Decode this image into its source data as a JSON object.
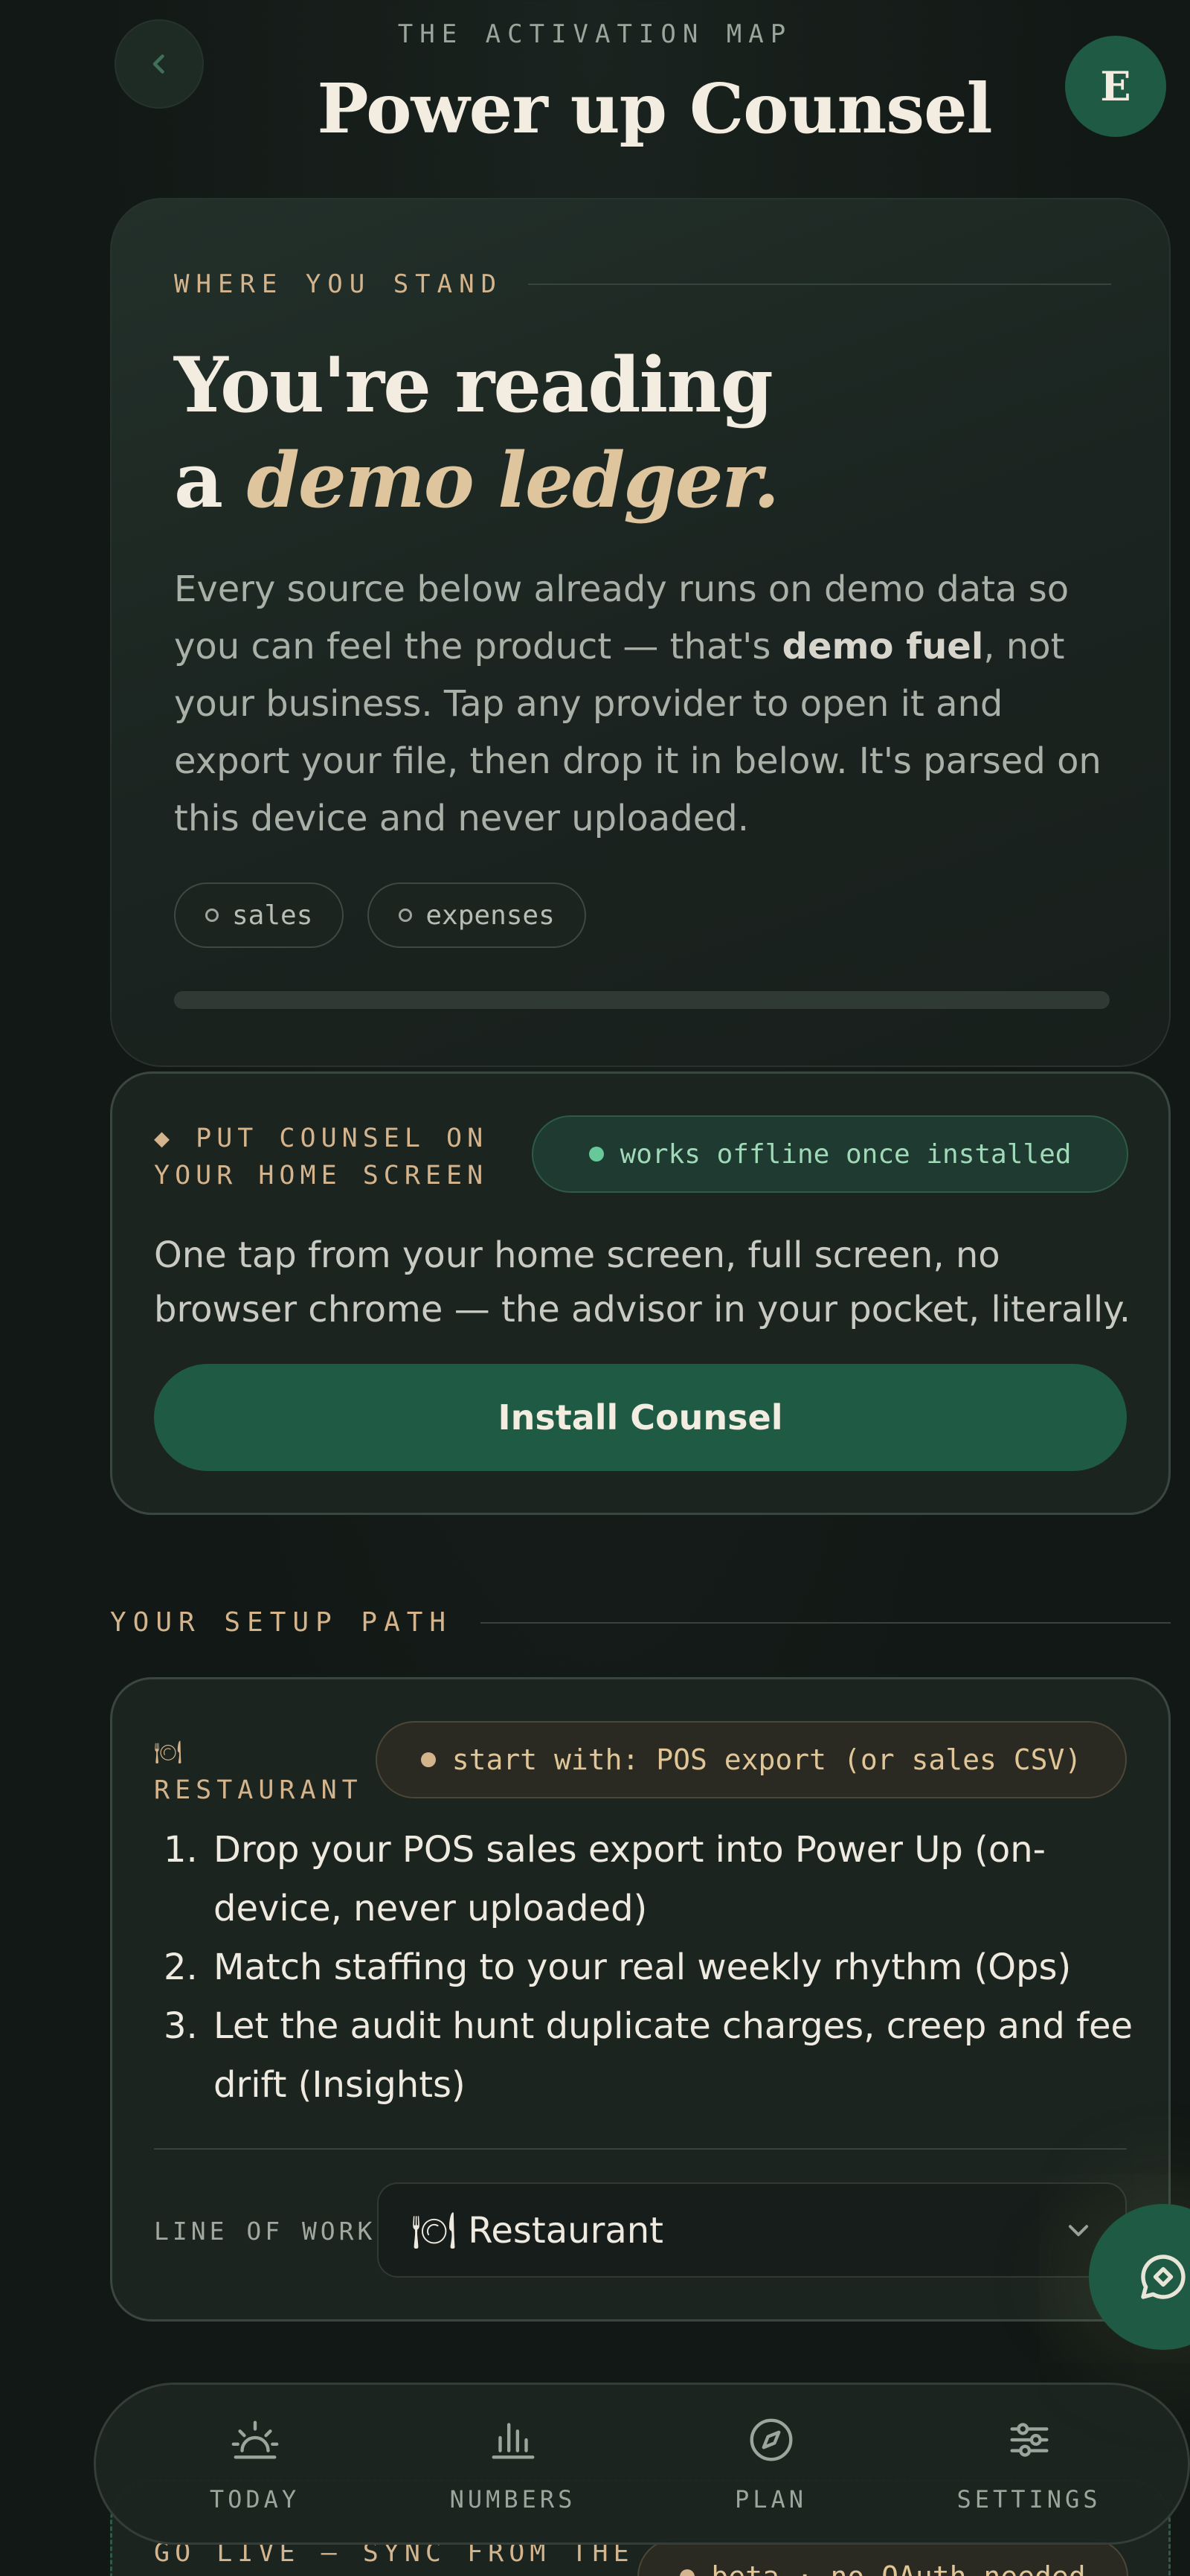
{
  "header": {
    "eyebrow": "THE ACTIVATION MAP",
    "title": "Power up Counsel",
    "avatar_initial": "E"
  },
  "hero": {
    "kicker": "WHERE YOU STAND",
    "headline_line1": "You're reading",
    "headline_a": "a",
    "headline_em": "demo ledger.",
    "lead_before": "Every source below already runs on demo data so you can feel the product — that's ",
    "lead_bold": "demo fuel",
    "lead_after": ", not your business. Tap any provider to open it and export your file, then drop it in below. It's parsed on this device and never uploaded.",
    "chips": [
      "sales",
      "expenses"
    ],
    "progress_fraction": 0
  },
  "install": {
    "label": "◆ PUT COUNSEL ON YOUR HOME SCREEN",
    "offline_badge": "works offline once installed",
    "body": "One tap from your home screen, full screen, no browser chrome — the advisor in your pocket, literally.",
    "button": "Install Counsel"
  },
  "setup": {
    "section_title": "YOUR SETUP PATH",
    "business_icon": "🍽",
    "business_label": "RESTAURANT",
    "start_badge": "start with: POS export (or sales CSV)",
    "steps": [
      "Drop your POS sales export into Power Up (on-device, never uploaded)",
      "Match staffing to your real weekly rhythm (Ops)",
      "Let the audit hunt duplicate charges, creep and fee drift (Insights)"
    ],
    "line_of_work_label": "LINE OF WORK",
    "line_of_work_value": "🍽 Restaurant"
  },
  "peek": {
    "label": "GO LIVE — SYNC FROM THE",
    "badge": "beta · no OAuth needed"
  },
  "nav": {
    "items": [
      {
        "label": "TODAY",
        "icon": "sunrise-icon"
      },
      {
        "label": "NUMBERS",
        "icon": "bar-chart-icon"
      },
      {
        "label": "PLAN",
        "icon": "compass-icon"
      },
      {
        "label": "SETTINGS",
        "icon": "sliders-icon"
      }
    ]
  },
  "colors": {
    "background": "#121815",
    "accent_green": "#1f5a45",
    "accent_gold": "#d3b48c"
  }
}
